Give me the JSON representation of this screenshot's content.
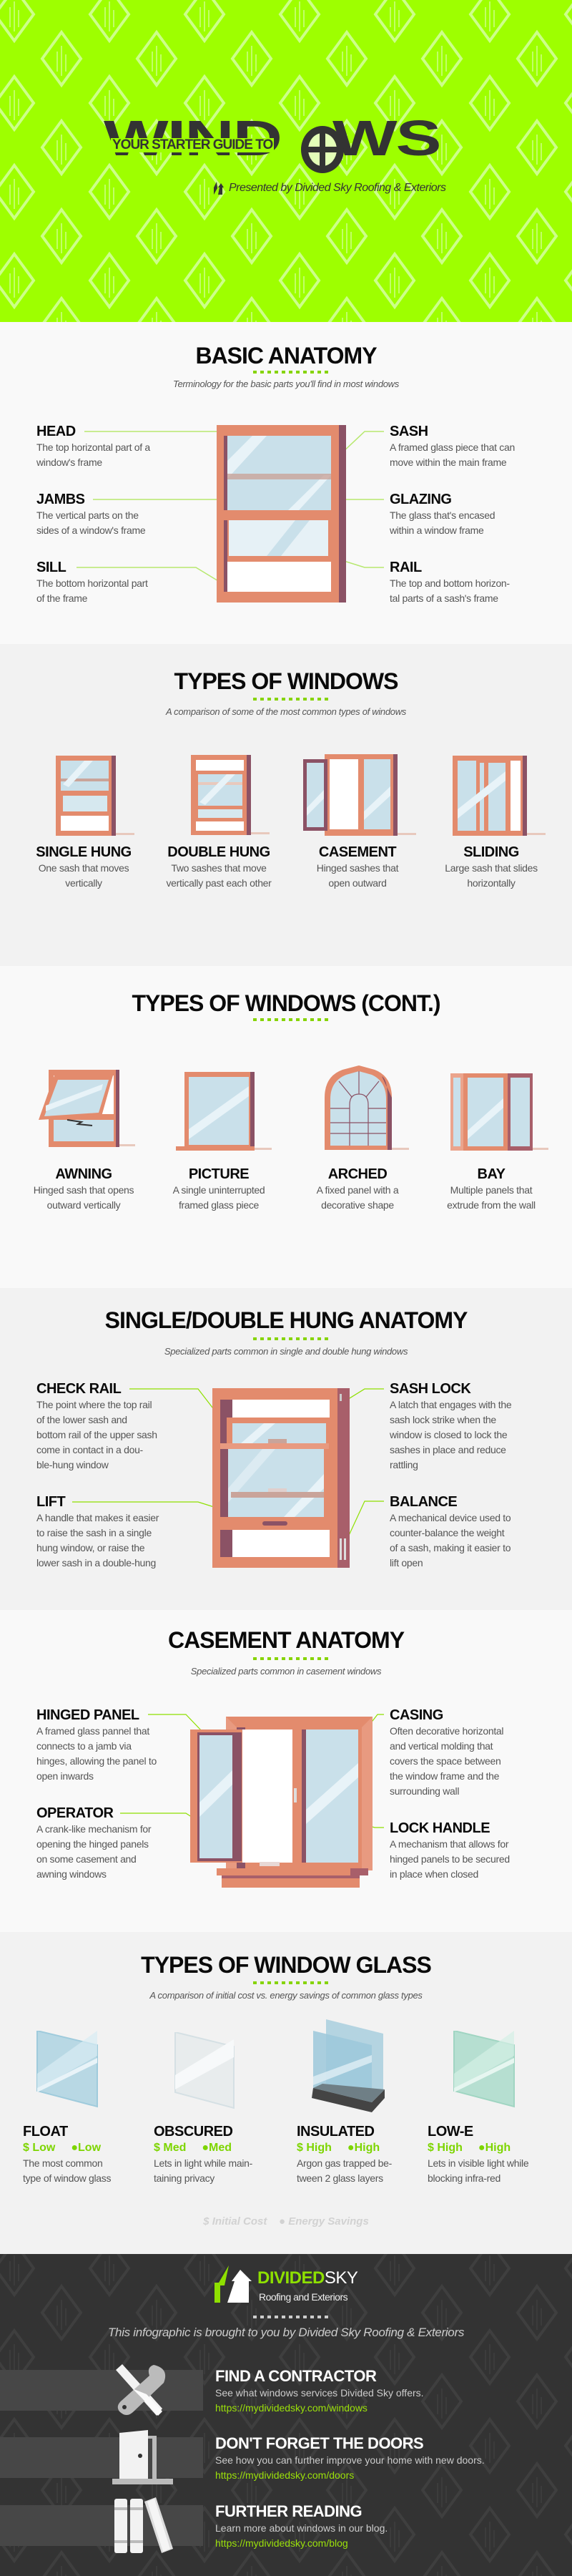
{
  "colors": {
    "hero_bg": "#9eff00",
    "accent": "#86d400",
    "frame": "#e38b6d",
    "frame_dark": "#8b5265",
    "glass": "#c9e0ea",
    "footer_bg": "#333333",
    "link": "#9be10a"
  },
  "hero": {
    "kicker": "YOUR STARTER GUIDE TO",
    "title_start": "WIND",
    "title_end": "WS",
    "title_icon": "round-window-icon",
    "presented": "Presented by Divided Sky Roofing & Exteriors",
    "presented_icon": "divided-sky-logo-icon"
  },
  "basic": {
    "title": "BASIC ANATOMY",
    "subtitle": "Terminology for the basic parts you'll find in most windows",
    "left": [
      {
        "name": "HEAD",
        "desc": [
          "The top horizontal part of a",
          "window's frame"
        ]
      },
      {
        "name": "JAMBS",
        "desc": [
          "The vertical parts on the",
          "sides of a window's frame"
        ]
      },
      {
        "name": "SILL",
        "desc": [
          "The bottom horizontal part",
          "of the frame"
        ]
      }
    ],
    "right": [
      {
        "name": "SASH",
        "desc": [
          "A framed glass piece that can",
          "move within the main frame"
        ]
      },
      {
        "name": "GLAZING",
        "desc": [
          "The glass that's encased",
          "within a window frame"
        ]
      },
      {
        "name": "RAIL",
        "desc": [
          "The top and bottom horizon-",
          "tal parts of a sash's frame"
        ]
      }
    ]
  },
  "types": {
    "title": "TYPES OF WINDOWS",
    "subtitle": "A comparison of some of the most common types of windows",
    "items": [
      {
        "name": "SINGLE HUNG",
        "desc": [
          "One sash that moves",
          "vertically"
        ]
      },
      {
        "name": "DOUBLE HUNG",
        "desc": [
          "Two sashes that move",
          "vertically past each other"
        ]
      },
      {
        "name": "CASEMENT",
        "desc": [
          "Hinged sashes that",
          "open outward"
        ]
      },
      {
        "name": "SLIDING",
        "desc": [
          "Large sash that slides",
          "horizontally"
        ]
      }
    ]
  },
  "types2": {
    "title": "TYPES OF WINDOWS (CONT.)",
    "items": [
      {
        "name": "AWNING",
        "desc": [
          "Hinged sash that opens",
          "outward vertically"
        ]
      },
      {
        "name": "PICTURE",
        "desc": [
          "A single uninterrupted",
          "framed glass piece"
        ]
      },
      {
        "name": "ARCHED",
        "desc": [
          "A fixed panel with a",
          "decorative shape"
        ]
      },
      {
        "name": "BAY",
        "desc": [
          "Multiple panels that",
          "extrude from the wall"
        ]
      }
    ]
  },
  "hung": {
    "title": "SINGLE/DOUBLE HUNG ANATOMY",
    "subtitle": "Specialized parts common in single and double hung windows",
    "left": [
      {
        "name": "CHECK RAIL",
        "desc": [
          "The point where the top rail",
          "of the lower sash and",
          "bottom rail of the upper sash",
          "come in contact in a dou-",
          "ble-hung window"
        ]
      },
      {
        "name": "LIFT",
        "desc": [
          "A handle that makes it easier",
          "to raise the sash in a single",
          "hung window, or raise the",
          "lower sash in a double-hung"
        ]
      }
    ],
    "right": [
      {
        "name": "SASH LOCK",
        "desc": [
          "A latch that engages with the",
          "sash lock strike when the",
          "window is closed to lock the",
          "sashes in place and reduce",
          "rattling"
        ]
      },
      {
        "name": "BALANCE",
        "desc": [
          "A mechanical device used to",
          "counter-balance the weight",
          "of a sash, making it easier to",
          "lift open"
        ]
      }
    ]
  },
  "casement": {
    "title": "CASEMENT ANATOMY",
    "subtitle": "Specialized parts common in casement windows",
    "left": [
      {
        "name": "HINGED PANEL",
        "desc": [
          "A framed glass pannel that",
          "connects to a jamb via",
          "hinges, allowing the panel to",
          "open inwards"
        ]
      },
      {
        "name": "OPERATOR",
        "desc": [
          "A crank-like mechanism for",
          "opening the hinged panels",
          "on some casement and",
          "awning windows"
        ]
      }
    ],
    "right": [
      {
        "name": "CASING",
        "desc": [
          "Often decorative horizontal",
          "and vertical molding that",
          "covers the space between",
          "the window frame and the",
          "surrounding wall"
        ]
      },
      {
        "name": "LOCK HANDLE",
        "desc": [
          "A mechanism that allows for",
          "hinged panels to be secured",
          "in place when closed"
        ]
      }
    ]
  },
  "glass": {
    "title": "TYPES OF WINDOW GLASS",
    "subtitle": "A comparison of initial cost vs. energy savings of common glass types",
    "items": [
      {
        "name": "FLOAT",
        "cost": "Low",
        "savings": "Low",
        "desc": [
          "The most common",
          "type of window glass"
        ]
      },
      {
        "name": "OBSCURED",
        "cost": "Med",
        "savings": "Med",
        "desc": [
          "Lets in light while main-",
          "taining privacy"
        ]
      },
      {
        "name": "INSULATED",
        "cost": "High",
        "savings": "High",
        "desc": [
          "Argon gas trapped be-",
          "tween 2 glass layers"
        ]
      },
      {
        "name": "LOW-E",
        "cost": "High",
        "savings": "High",
        "desc": [
          "Lets in visible light while",
          "blocking infra-red"
        ]
      }
    ],
    "cost_symbol": "$",
    "legend": {
      "cost": "Initial Cost",
      "savings": "Energy Savings"
    }
  },
  "footer": {
    "brand_a": "DIVIDED",
    "brand_b": "SKY",
    "brand_sub": "Roofing and Exteriors",
    "tagline": "This infographic is brought to you by Divided Sky Roofing & Exteriors",
    "rows": [
      {
        "icon": "tools-icon",
        "title": "FIND A CONTRACTOR",
        "desc": "See what windows services Divided Sky offers.",
        "url": "https://mydividedsky.com/windows"
      },
      {
        "icon": "door-icon",
        "title": "DON'T FORGET THE DOORS",
        "desc": "See how you can further improve your home with new doors.",
        "url": "https://mydividedsky.com/doors"
      },
      {
        "icon": "books-icon",
        "title": "FURTHER READING",
        "desc": "Learn more about windows in our blog.",
        "url": "https://mydividedsky.com/blog"
      }
    ]
  }
}
